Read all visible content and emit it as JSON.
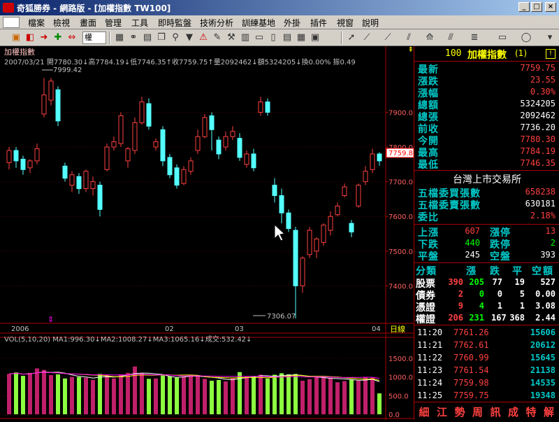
{
  "window": {
    "title": "奇狐勝券 - 網路版 - [加權指數 TW100]",
    "buttons": [
      "_",
      "□",
      "×"
    ]
  },
  "menu": [
    "檔案",
    "檢視",
    "畫面",
    "管理",
    "工具",
    "即時監盤",
    "技術分析",
    "訓練基地",
    "外掛",
    "插件",
    "視窗",
    "說明"
  ],
  "toolbar": {
    "combo": "權"
  },
  "chart": {
    "title": "加權指數",
    "info_line": "2007/03/21 開7780.30↓高7784.19↓低7746.35↑收7759.75↑量2092462↓額5324205↓換0.00% 振0.49",
    "high_mark": "7999.42",
    "low_mark": "7306.07",
    "current_tag": "7759.8",
    "price_ticks": [
      "7900.0",
      "7800.0",
      "7700.0",
      "7600.0",
      "7500.0",
      "7400.0"
    ],
    "date_labels": [
      "2006",
      "02",
      "03",
      "04"
    ],
    "period_button": "日線",
    "vol_info": "VOL(5,10,20) MA1:996.30↓MA2:1008.27↓MA3:1065.16↓成交:532.42↓",
    "vol_ticks": [
      "1500.0",
      "1000.0",
      "500.0",
      "0.0"
    ]
  },
  "chart_data": {
    "type": "candlestick",
    "title": "加權指數",
    "price_axis": {
      "ylim": [
        7300,
        8030
      ],
      "ticks": [
        7400,
        7500,
        7600,
        7700,
        7800,
        7900
      ]
    },
    "candles": [
      {
        "o": 7755,
        "c": 7790,
        "h": 7800,
        "l": 7735
      },
      {
        "o": 7790,
        "c": 7760,
        "h": 7800,
        "l": 7740
      },
      {
        "o": 7765,
        "c": 7735,
        "h": 7775,
        "l": 7720
      },
      {
        "o": 7740,
        "c": 7760,
        "h": 7765,
        "l": 7725
      },
      {
        "o": 7760,
        "c": 7795,
        "h": 7810,
        "l": 7750
      },
      {
        "o": 7895,
        "c": 7950,
        "h": 7999,
        "l": 7885
      },
      {
        "o": 7935,
        "c": 7990,
        "h": 7999,
        "l": 7920
      },
      {
        "o": 7965,
        "c": 7875,
        "h": 7975,
        "l": 7860
      },
      {
        "o": 7745,
        "c": 7710,
        "h": 7755,
        "l": 7700
      },
      {
        "o": 7690,
        "c": 7720,
        "h": 7730,
        "l": 7670
      },
      {
        "o": 7715,
        "c": 7680,
        "h": 7725,
        "l": 7665
      },
      {
        "o": 7680,
        "c": 7730,
        "h": 7735,
        "l": 7670
      },
      {
        "o": 7680,
        "c": 7700,
        "h": 7715,
        "l": 7660
      },
      {
        "o": 7690,
        "c": 7620,
        "h": 7700,
        "l": 7600
      },
      {
        "o": 7735,
        "c": 7800,
        "h": 7810,
        "l": 7730
      },
      {
        "o": 7800,
        "c": 7815,
        "h": 7830,
        "l": 7790
      },
      {
        "o": 7810,
        "c": 7890,
        "h": 7900,
        "l": 7800
      },
      {
        "o": 7760,
        "c": 7795,
        "h": 7800,
        "l": 7740
      },
      {
        "o": 7790,
        "c": 7870,
        "h": 7885,
        "l": 7780
      },
      {
        "o": 7870,
        "c": 7930,
        "h": 7945,
        "l": 7865
      },
      {
        "o": 7925,
        "c": 7860,
        "h": 7940,
        "l": 7850
      },
      {
        "o": 7800,
        "c": 7815,
        "h": 7825,
        "l": 7790
      },
      {
        "o": 7850,
        "c": 7760,
        "h": 7860,
        "l": 7745
      },
      {
        "o": 7770,
        "c": 7720,
        "h": 7780,
        "l": 7710
      },
      {
        "o": 7740,
        "c": 7690,
        "h": 7750,
        "l": 7680
      },
      {
        "o": 7695,
        "c": 7735,
        "h": 7745,
        "l": 7690
      },
      {
        "o": 7730,
        "c": 7760,
        "h": 7770,
        "l": 7720
      },
      {
        "o": 7790,
        "c": 7830,
        "h": 7850,
        "l": 7780
      },
      {
        "o": 7830,
        "c": 7885,
        "h": 7895,
        "l": 7825
      },
      {
        "o": 7890,
        "c": 7850,
        "h": 7900,
        "l": 7790
      },
      {
        "o": 7820,
        "c": 7780,
        "h": 7830,
        "l": 7765
      },
      {
        "o": 7800,
        "c": 7830,
        "h": 7845,
        "l": 7790
      },
      {
        "o": 7830,
        "c": 7845,
        "h": 7860,
        "l": 7820
      },
      {
        "o": 7825,
        "c": 7770,
        "h": 7840,
        "l": 7760
      },
      {
        "o": 7750,
        "c": 7780,
        "h": 7790,
        "l": 7740
      },
      {
        "o": 7780,
        "c": 7740,
        "h": 7795,
        "l": 7730
      },
      {
        "o": 7900,
        "c": 7930,
        "h": 7945,
        "l": 7890
      },
      {
        "o": 7930,
        "c": 7900,
        "h": 7940,
        "l": 7890
      },
      {
        "o": 7690,
        "c": 7660,
        "h": 7710,
        "l": 7640
      },
      {
        "o": 7660,
        "c": 7610,
        "h": 7680,
        "l": 7580
      },
      {
        "o": 7610,
        "c": 7565,
        "h": 7620,
        "l": 7555
      },
      {
        "o": 7560,
        "c": 7400,
        "h": 7570,
        "l": 7306
      },
      {
        "o": 7400,
        "c": 7480,
        "h": 7485,
        "l": 7380
      },
      {
        "o": 7490,
        "c": 7560,
        "h": 7570,
        "l": 7480
      },
      {
        "o": 7500,
        "c": 7535,
        "h": 7540,
        "l": 7480
      },
      {
        "o": 7525,
        "c": 7575,
        "h": 7580,
        "l": 7515
      },
      {
        "o": 7560,
        "c": 7600,
        "h": 7615,
        "l": 7545
      },
      {
        "o": 7605,
        "c": 7630,
        "h": 7640,
        "l": 7600
      },
      {
        "o": 7660,
        "c": 7685,
        "h": 7695,
        "l": 7655
      },
      {
        "o": 7580,
        "c": 7555,
        "h": 7590,
        "l": 7540
      },
      {
        "o": 7630,
        "c": 7690,
        "h": 7695,
        "l": 7625
      },
      {
        "o": 7700,
        "c": 7730,
        "h": 7745,
        "l": 7690
      },
      {
        "o": 7735,
        "c": 7780,
        "h": 7795,
        "l": 7725
      },
      {
        "o": 7780,
        "c": 7760,
        "h": 7785,
        "l": 7746
      }
    ],
    "volume_axis": {
      "ylim": [
        0,
        1800
      ],
      "ticks": [
        0,
        500,
        1000,
        1500
      ]
    },
    "volume": [
      1080,
      1120,
      1030,
      1110,
      1230,
      1190,
      1050,
      1070,
      960,
      1000,
      1000,
      980,
      920,
      1080,
      1050,
      960,
      1070,
      1110,
      1280,
      1100,
      950,
      960,
      1040,
      1020,
      980,
      1010,
      1060,
      1040,
      950,
      900,
      920,
      880,
      970,
      1130,
      1010,
      1000,
      1060,
      960,
      1060,
      1100,
      1070,
      1080,
      900,
      940,
      1010,
      990,
      980,
      860,
      890,
      930,
      900,
      1000,
      980,
      560
    ],
    "volume_up": [
      1,
      0,
      0,
      1,
      1,
      1,
      1,
      0,
      0,
      1,
      0,
      1,
      1,
      0,
      1,
      1,
      1,
      1,
      1,
      1,
      0,
      1,
      0,
      0,
      0,
      1,
      1,
      1,
      1,
      0,
      0,
      1,
      1,
      0,
      1,
      0,
      1,
      0,
      0,
      0,
      0,
      0,
      1,
      1,
      1,
      1,
      1,
      1,
      1,
      0,
      1,
      1,
      1,
      0
    ]
  },
  "quote": {
    "code": "100",
    "name": "加權指數",
    "badge": "(1)",
    "rows": [
      {
        "label": "最新",
        "value": "7759.75",
        "color": "red"
      },
      {
        "label": "漲跌",
        "value": "23.55",
        "color": "red"
      },
      {
        "label": "漲幅",
        "value": "0.30%",
        "color": "red"
      },
      {
        "label": "總額",
        "value": "5324205",
        "color": "wht"
      },
      {
        "label": "總張",
        "value": "2092462",
        "color": "wht"
      },
      {
        "label": "前收",
        "value": "7736.20",
        "color": "wht"
      },
      {
        "label": "今開",
        "value": "7780.30",
        "color": "red"
      },
      {
        "label": "最高",
        "value": "7784.19",
        "color": "red"
      },
      {
        "label": "最低",
        "value": "7746.35",
        "color": "red"
      }
    ],
    "exchange": "台灣上市交易所",
    "rows2": [
      {
        "label": "五檔委買張數",
        "value": "658238",
        "color": "red"
      },
      {
        "label": "五檔委賣張數",
        "value": "630181",
        "color": "wht"
      },
      {
        "label": "委比",
        "value": "2.18%",
        "color": "red"
      }
    ],
    "breadth": [
      {
        "l1": "上漲",
        "v1": "607",
        "l2": "漲停",
        "v2": "13",
        "c": "red"
      },
      {
        "l1": "下跌",
        "v1": "440",
        "l2": "跌停",
        "v2": "2",
        "c": "grn"
      },
      {
        "l1": "平盤",
        "v1": "245",
        "l2": "空盤",
        "v2": "393",
        "c": "wht"
      }
    ],
    "class_header": [
      "分類",
      "漲",
      "跌",
      "平",
      "空",
      "額"
    ],
    "class_rows": [
      {
        "name": "股票",
        "v": [
          "390",
          "205",
          "77",
          "19",
          "527"
        ]
      },
      {
        "name": "債券",
        "v": [
          "2",
          "0",
          "0",
          "5",
          "0.00"
        ]
      },
      {
        "name": "憑證",
        "v": [
          "9",
          "4",
          "1",
          "1",
          "3.08"
        ]
      },
      {
        "name": "權證",
        "v": [
          "206",
          "231",
          "167",
          "368",
          "2.44"
        ]
      }
    ],
    "ticks": [
      {
        "t": "11:20",
        "p": "7761.26",
        "v": "15606"
      },
      {
        "t": "11:21",
        "p": "7762.61",
        "v": "20612"
      },
      {
        "t": "11:22",
        "p": "7760.99",
        "v": "15645"
      },
      {
        "t": "11:23",
        "p": "7761.54",
        "v": "21138"
      },
      {
        "t": "11:24",
        "p": "7759.98",
        "v": "14535"
      },
      {
        "t": "11:25",
        "p": "7759.75",
        "v": "19348"
      }
    ],
    "tabs": [
      "細",
      "江",
      "勢",
      "周",
      "訊",
      "成",
      "特",
      "解"
    ]
  }
}
